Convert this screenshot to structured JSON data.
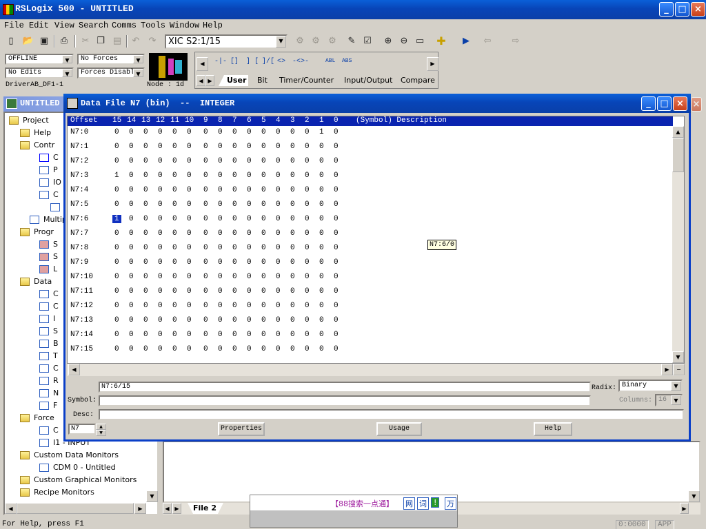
{
  "window": {
    "title": "RSLogix 500 - UNTITLED",
    "minimize": "_",
    "maximize": "□",
    "close": "×"
  },
  "menu": [
    "File",
    "Edit",
    "View",
    "Search",
    "Comms",
    "Tools",
    "Window",
    "Help"
  ],
  "toolbar": {
    "instruction_combo": "XIC S2:1/15"
  },
  "status_panel": {
    "mode": "OFFLINE",
    "forces": "No Forces",
    "edits": "No Edits",
    "forces_state": "Forces Disable",
    "driver": "DriverAB_DF1-1",
    "node": "Node : 1d"
  },
  "instruction_tabs": [
    "User",
    "Bit",
    "Timer/Counter",
    "Input/Output",
    "Compare"
  ],
  "instruction_symbols": [
    "-|-",
    "[]",
    "] [",
    "]/[",
    "<>",
    "-<>-",
    "ABL",
    "ABS"
  ],
  "project": {
    "title": "UNTITLED",
    "items": [
      {
        "label": "Project",
        "icon": "folder"
      },
      {
        "label": "Help",
        "icon": "folder"
      },
      {
        "label": "Contr",
        "icon": "folder"
      },
      {
        "label": "C",
        "icon": "info"
      },
      {
        "label": "P",
        "icon": "key"
      },
      {
        "label": "IO",
        "icon": "io"
      },
      {
        "label": "C",
        "icon": "chan"
      },
      {
        "label": "",
        "icon": "doc"
      },
      {
        "label": "Multip",
        "icon": "doc"
      },
      {
        "label": "Progr",
        "icon": "folder"
      },
      {
        "label": "S",
        "icon": "ladder"
      },
      {
        "label": "S",
        "icon": "ladder"
      },
      {
        "label": "L",
        "icon": "ladder"
      },
      {
        "label": "Data",
        "icon": "folder"
      },
      {
        "label": "C",
        "icon": "doc"
      },
      {
        "label": "C",
        "icon": "doc"
      },
      {
        "label": "I",
        "icon": "doc"
      },
      {
        "label": "S",
        "icon": "doc"
      },
      {
        "label": "B",
        "icon": "doc"
      },
      {
        "label": "T",
        "icon": "doc"
      },
      {
        "label": "C",
        "icon": "doc"
      },
      {
        "label": "R",
        "icon": "doc"
      },
      {
        "label": "N",
        "icon": "doc"
      },
      {
        "label": "F",
        "icon": "doc"
      },
      {
        "label": "Force",
        "icon": "folder"
      },
      {
        "label": "C",
        "icon": "doc"
      },
      {
        "label": "I1 - INPUT",
        "icon": "doc"
      },
      {
        "label": "Custom Data Monitors",
        "icon": "folder"
      },
      {
        "label": "CDM 0 - Untitled",
        "icon": "doc"
      },
      {
        "label": "Custom Graphical Monitors",
        "icon": "folder"
      },
      {
        "label": "Recipe Monitors",
        "icon": "folder"
      }
    ]
  },
  "data_file": {
    "title": "Data File N7 (bin)  --  INTEGER",
    "header": {
      "offset": "Offset",
      "bits": [
        "15",
        "14",
        "13",
        "12",
        "11",
        "10",
        "9",
        "8",
        "7",
        "6",
        "5",
        "4",
        "3",
        "2",
        "1",
        "0"
      ],
      "desc": "(Symbol) Description"
    },
    "rows": [
      {
        "addr": "N7:0",
        "bits": [
          0,
          0,
          0,
          0,
          0,
          0,
          0,
          0,
          0,
          0,
          0,
          0,
          0,
          0,
          1,
          0
        ]
      },
      {
        "addr": "N7:1",
        "bits": [
          0,
          0,
          0,
          0,
          0,
          0,
          0,
          0,
          0,
          0,
          0,
          0,
          0,
          0,
          0,
          0
        ]
      },
      {
        "addr": "N7:2",
        "bits": [
          0,
          0,
          0,
          0,
          0,
          0,
          0,
          0,
          0,
          0,
          0,
          0,
          0,
          0,
          0,
          0
        ]
      },
      {
        "addr": "N7:3",
        "bits": [
          1,
          0,
          0,
          0,
          0,
          0,
          0,
          0,
          0,
          0,
          0,
          0,
          0,
          0,
          0,
          0
        ]
      },
      {
        "addr": "N7:4",
        "bits": [
          0,
          0,
          0,
          0,
          0,
          0,
          0,
          0,
          0,
          0,
          0,
          0,
          0,
          0,
          0,
          0
        ]
      },
      {
        "addr": "N7:5",
        "bits": [
          0,
          0,
          0,
          0,
          0,
          0,
          0,
          0,
          0,
          0,
          0,
          0,
          0,
          0,
          0,
          0
        ]
      },
      {
        "addr": "N7:6",
        "bits": [
          1,
          0,
          0,
          0,
          0,
          0,
          0,
          0,
          0,
          0,
          0,
          0,
          0,
          0,
          0,
          0
        ]
      },
      {
        "addr": "N7:7",
        "bits": [
          0,
          0,
          0,
          0,
          0,
          0,
          0,
          0,
          0,
          0,
          0,
          0,
          0,
          0,
          0,
          0
        ]
      },
      {
        "addr": "N7:8",
        "bits": [
          0,
          0,
          0,
          0,
          0,
          0,
          0,
          0,
          0,
          0,
          0,
          0,
          0,
          0,
          0,
          0
        ]
      },
      {
        "addr": "N7:9",
        "bits": [
          0,
          0,
          0,
          0,
          0,
          0,
          0,
          0,
          0,
          0,
          0,
          0,
          0,
          0,
          0,
          0
        ]
      },
      {
        "addr": "N7:10",
        "bits": [
          0,
          0,
          0,
          0,
          0,
          0,
          0,
          0,
          0,
          0,
          0,
          0,
          0,
          0,
          0,
          0
        ]
      },
      {
        "addr": "N7:11",
        "bits": [
          0,
          0,
          0,
          0,
          0,
          0,
          0,
          0,
          0,
          0,
          0,
          0,
          0,
          0,
          0,
          0
        ]
      },
      {
        "addr": "N7:12",
        "bits": [
          0,
          0,
          0,
          0,
          0,
          0,
          0,
          0,
          0,
          0,
          0,
          0,
          0,
          0,
          0,
          0
        ]
      },
      {
        "addr": "N7:13",
        "bits": [
          0,
          0,
          0,
          0,
          0,
          0,
          0,
          0,
          0,
          0,
          0,
          0,
          0,
          0,
          0,
          0
        ]
      },
      {
        "addr": "N7:14",
        "bits": [
          0,
          0,
          0,
          0,
          0,
          0,
          0,
          0,
          0,
          0,
          0,
          0,
          0,
          0,
          0,
          0
        ]
      },
      {
        "addr": "N7:15",
        "bits": [
          0,
          0,
          0,
          0,
          0,
          0,
          0,
          0,
          0,
          0,
          0,
          0,
          0,
          0,
          0,
          0
        ]
      }
    ],
    "selected": {
      "row": 6,
      "bit_index": 0
    },
    "tooltip": "N7:6/0",
    "address_field": "N7:6/15",
    "symbol_label": "Symbol:",
    "symbol_value": "",
    "desc_label": "Desc:",
    "desc_value": "",
    "radix_label": "Radix:",
    "radix_value": "Binary",
    "columns_label": "Columns:",
    "columns_value": "16",
    "file_spinner": "N7",
    "buttons": {
      "properties": "Properties",
      "usage": "Usage",
      "help": "Help"
    }
  },
  "mdi_tab": "File 2",
  "ime_bar": {
    "search": "【88搜索一点通】",
    "b1": "网",
    "b2": "词",
    "b3": "!",
    "b4": "万"
  },
  "status": {
    "help": "For Help, press F1",
    "pos": "0:0000",
    "app": "APP"
  },
  "colors": {
    "titlebar": "#0845b8",
    "selection": "#1030c0",
    "grid_header": "#0a24b0"
  }
}
